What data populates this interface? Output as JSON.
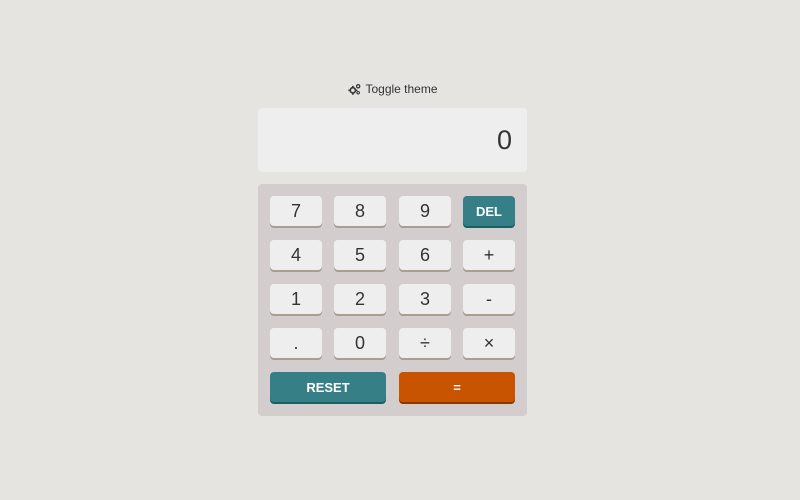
{
  "theme_toggle": {
    "icon": "gears-icon",
    "label": "Toggle theme"
  },
  "display": {
    "value": "0"
  },
  "keys": {
    "seven": "7",
    "eight": "8",
    "nine": "9",
    "del": "DEL",
    "four": "4",
    "five": "5",
    "six": "6",
    "plus": "+",
    "one": "1",
    "two": "2",
    "three": "3",
    "minus": "-",
    "decimal": ".",
    "zero": "0",
    "divide": "÷",
    "multiply": "×",
    "reset": "RESET",
    "equals": "="
  },
  "colors": {
    "background": "#e6e4e0",
    "keypad": "#d3cdcd",
    "key": "#eeeeee",
    "accent_teal": "#377f86",
    "accent_orange": "#c85402"
  }
}
